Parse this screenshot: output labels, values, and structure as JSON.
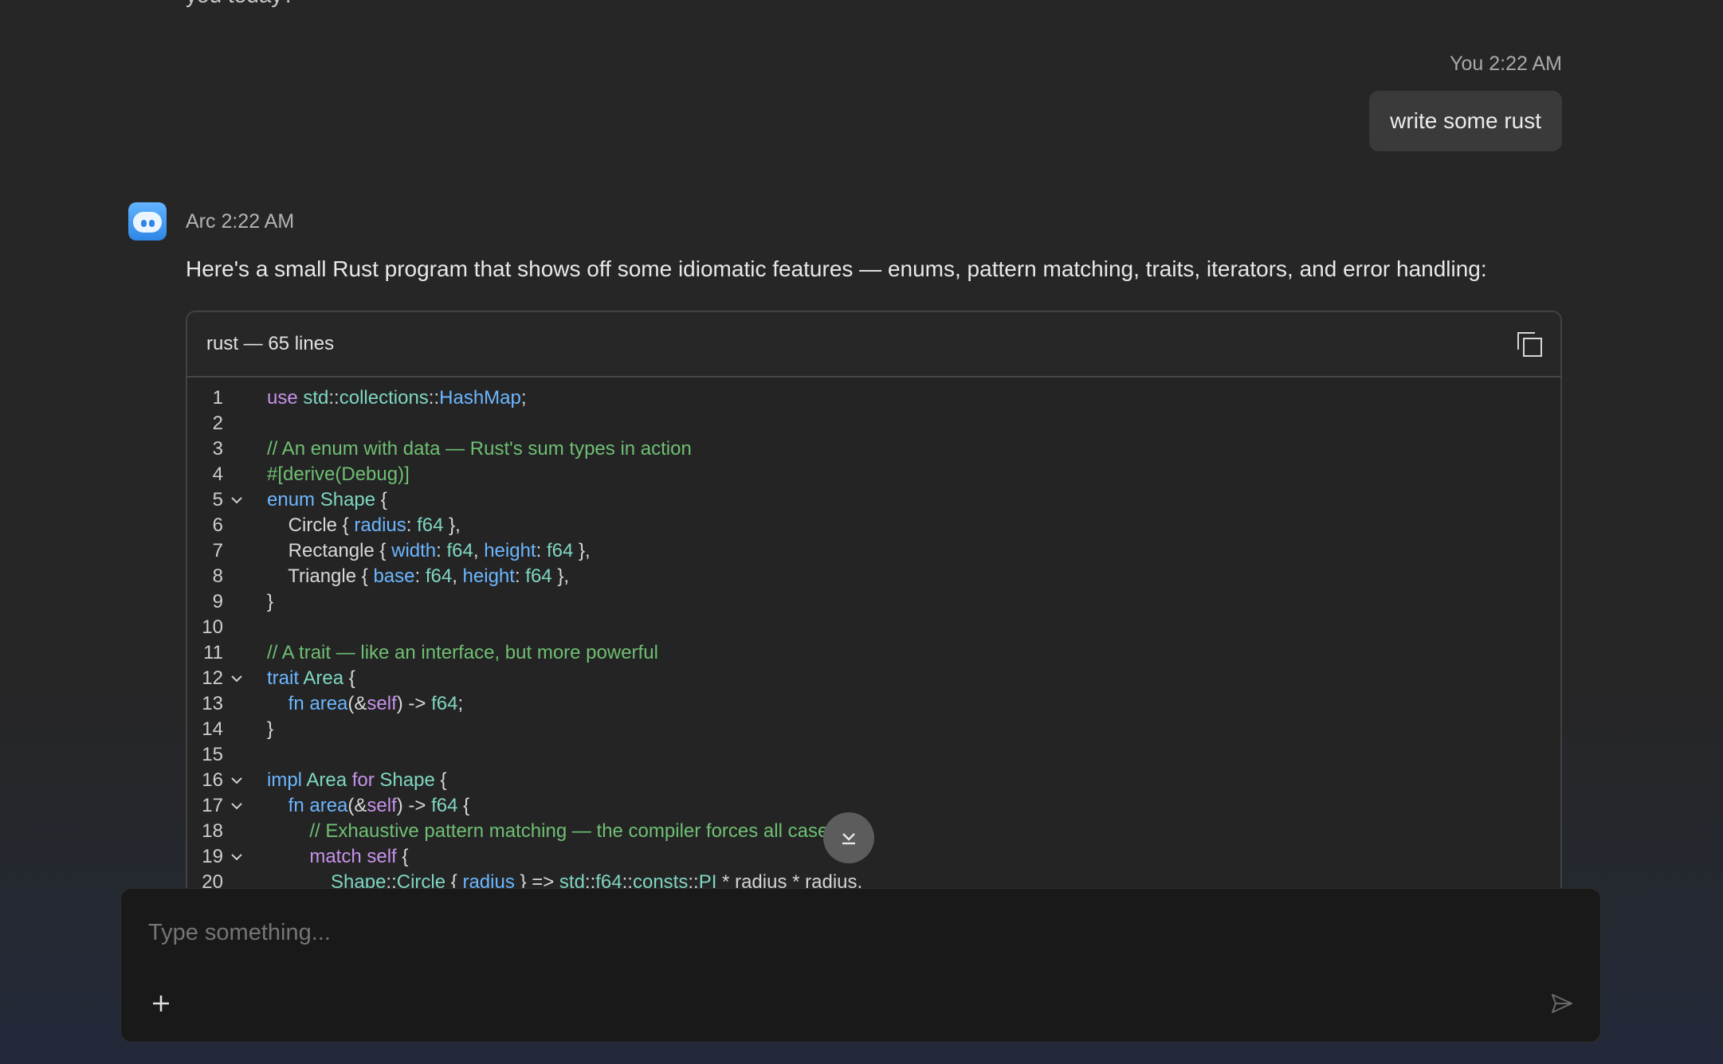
{
  "previous_message": {
    "partial_text": "you today?"
  },
  "user_message": {
    "author": "You",
    "time": "2:22 AM",
    "text": "write some rust"
  },
  "assistant_message": {
    "author": "Arc",
    "time": "2:22 AM",
    "intro": "Here's a small Rust program that shows off some idiomatic features — enums, pattern matching, traits, iterators, and error handling:",
    "code_block": {
      "title": "rust — 65 lines",
      "copy_icon": "copy-icon"
    }
  },
  "code_lines": [
    {
      "n": "1",
      "fold": false
    },
    {
      "n": "2",
      "fold": false
    },
    {
      "n": "3",
      "fold": false
    },
    {
      "n": "4",
      "fold": false
    },
    {
      "n": "5",
      "fold": true
    },
    {
      "n": "6",
      "fold": false
    },
    {
      "n": "7",
      "fold": false
    },
    {
      "n": "8",
      "fold": false
    },
    {
      "n": "9",
      "fold": false
    },
    {
      "n": "10",
      "fold": false
    },
    {
      "n": "11",
      "fold": false
    },
    {
      "n": "12",
      "fold": true
    },
    {
      "n": "13",
      "fold": false
    },
    {
      "n": "14",
      "fold": false
    },
    {
      "n": "15",
      "fold": false
    },
    {
      "n": "16",
      "fold": true
    },
    {
      "n": "17",
      "fold": true
    },
    {
      "n": "18",
      "fold": false
    },
    {
      "n": "19",
      "fold": true
    },
    {
      "n": "20",
      "fold": false
    }
  ],
  "code_tokens": {
    "l1": [
      "use",
      " ",
      "std",
      "::",
      "collections",
      "::",
      "HashMap",
      ";"
    ],
    "l3": "// An enum with data — Rust's sum types in action",
    "l4": "#[derive(Debug)]",
    "l5": [
      "enum",
      " ",
      "Shape",
      " {"
    ],
    "l6": [
      "Circle",
      " { ",
      "radius",
      ": ",
      "f64",
      " },"
    ],
    "l7": [
      "Rectangle",
      " { ",
      "width",
      ": ",
      "f64",
      ", ",
      "height",
      ": ",
      "f64",
      " },"
    ],
    "l8": [
      "Triangle",
      " { ",
      "base",
      ": ",
      "f64",
      ", ",
      "height",
      ": ",
      "f64",
      " },"
    ],
    "l9": "}",
    "l11": "// A trait — like an interface, but more powerful",
    "l12": [
      "trait",
      " ",
      "Area",
      " {"
    ],
    "l13": [
      "fn",
      " ",
      "area",
      "(&",
      "self",
      ") -> ",
      "f64",
      ";"
    ],
    "l14": "}",
    "l16": [
      "impl",
      " ",
      "Area",
      " ",
      "for",
      " ",
      "Shape",
      " {"
    ],
    "l17": [
      "fn",
      " ",
      "area",
      "(&",
      "self",
      ") -> ",
      "f64",
      " {"
    ],
    "l18": "// Exhaustive pattern matching — the compiler forces all cases",
    "l19": [
      "match",
      " ",
      "self",
      " {"
    ],
    "l20": [
      "Shape",
      "::",
      "Circle",
      " { ",
      "radius",
      " } => ",
      "std",
      "::",
      "f64",
      "::",
      "consts",
      "::",
      "PI",
      " * ",
      "radius",
      " * ",
      "radius",
      ","
    ]
  },
  "composer": {
    "placeholder": "Type something...",
    "plus_icon": "plus-icon",
    "send_icon": "send-icon"
  },
  "scroll_button": {
    "icon": "scroll-down-icon"
  }
}
